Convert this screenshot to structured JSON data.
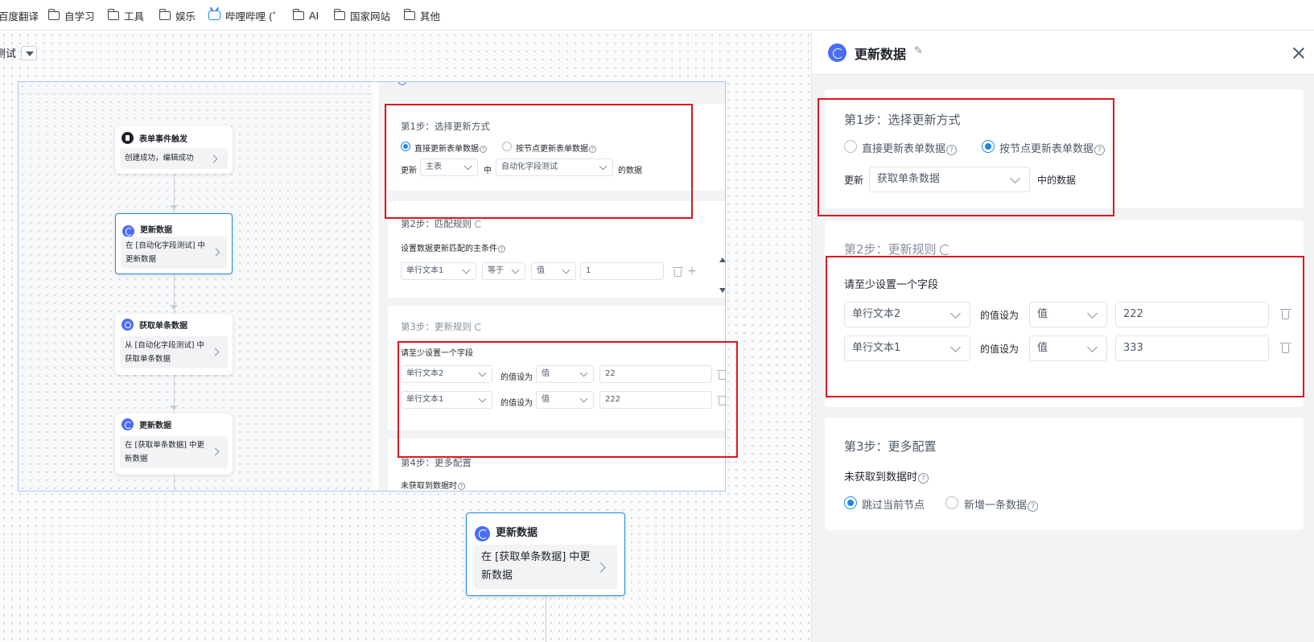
{
  "bookmarks": [
    {
      "label": "百度翻译",
      "icon": "none"
    },
    {
      "label": "自学习",
      "icon": "folder-icon"
    },
    {
      "label": "工具",
      "icon": "folder-icon"
    },
    {
      "label": "娱乐",
      "icon": "folder-icon"
    },
    {
      "label": "哔哩哔哩 (゜",
      "icon": "bilibili-icon"
    },
    {
      "label": "AI",
      "icon": "folder-icon"
    },
    {
      "label": "国家网站",
      "icon": "folder-icon"
    },
    {
      "label": "其他",
      "icon": "folder-icon"
    }
  ],
  "canvas": {
    "top_label": "测试",
    "nodes": {
      "trigger": {
        "title": "表单事件触发",
        "body": "创建成功，编辑成功"
      },
      "update1": {
        "title": "更新数据",
        "body_line1": "在 [自动化字段测试] 中",
        "body_line2": "更新数据"
      },
      "fetch": {
        "title": "获取单条数据",
        "body_line1": "从 [自动化字段测试] 中",
        "body_line2": "获取单条数据"
      },
      "update2": {
        "title": "更新数据",
        "body_line1": "在 [获取单条数据] 中更",
        "body_line2": "新数据"
      },
      "update3": {
        "title": "更新数据",
        "body_line1": "在 [获取单条数据] 中更",
        "body_line2": "新数据"
      }
    },
    "mini_panel": {
      "step1": {
        "title": "第1步：选择更新方式",
        "option_direct": "直接更新表单数据",
        "option_node": "按节点更新表单数据",
        "update_label": "更新",
        "main_select": "主表",
        "in_label": "中",
        "form_select": "自动化字段测试",
        "suffix": "的数据"
      },
      "step2": {
        "title": "第2步：匹配规则",
        "subtitle": "设置数据更新匹配的主条件",
        "field": "单行文本1",
        "operator": "等于",
        "value_type": "值",
        "value": "1"
      },
      "step3": {
        "title": "第3步：更新规则",
        "hint": "请至少设置一个字段",
        "set_label": "的值设为",
        "rows": [
          {
            "field": "单行文本2",
            "type": "值",
            "value": "22"
          },
          {
            "field": "单行文本1",
            "type": "值",
            "value": "222"
          }
        ]
      },
      "step4": {
        "title": "第4步：更多配置",
        "subtitle": "未获取到数据时"
      }
    }
  },
  "drawer": {
    "title": "更新数据",
    "step1": {
      "title": "第1步：选择更新方式",
      "option_direct": "直接更新表单数据",
      "option_node": "按节点更新表单数据",
      "selected": "option_node",
      "update_label": "更新",
      "node_select": "获取单条数据",
      "suffix": "中的数据"
    },
    "step2": {
      "title": "第2步：更新规则",
      "hint": "请至少设置一个字段",
      "set_label": "的值设为",
      "rows": [
        {
          "field": "单行文本2",
          "type": "值",
          "value": "222"
        },
        {
          "field": "单行文本1",
          "type": "值",
          "value": "333"
        }
      ]
    },
    "step3": {
      "title": "第3步：更多配置",
      "subtitle": "未获取到数据时",
      "option_skip": "跳过当前节点",
      "option_add": "新增一条数据",
      "selected": "option_skip"
    }
  },
  "colors": {
    "accent": "#1e88e5",
    "node_icon": "#4a6cf7",
    "highlight_box": "#e0151f",
    "panel_bg": "#f2f3f5"
  }
}
